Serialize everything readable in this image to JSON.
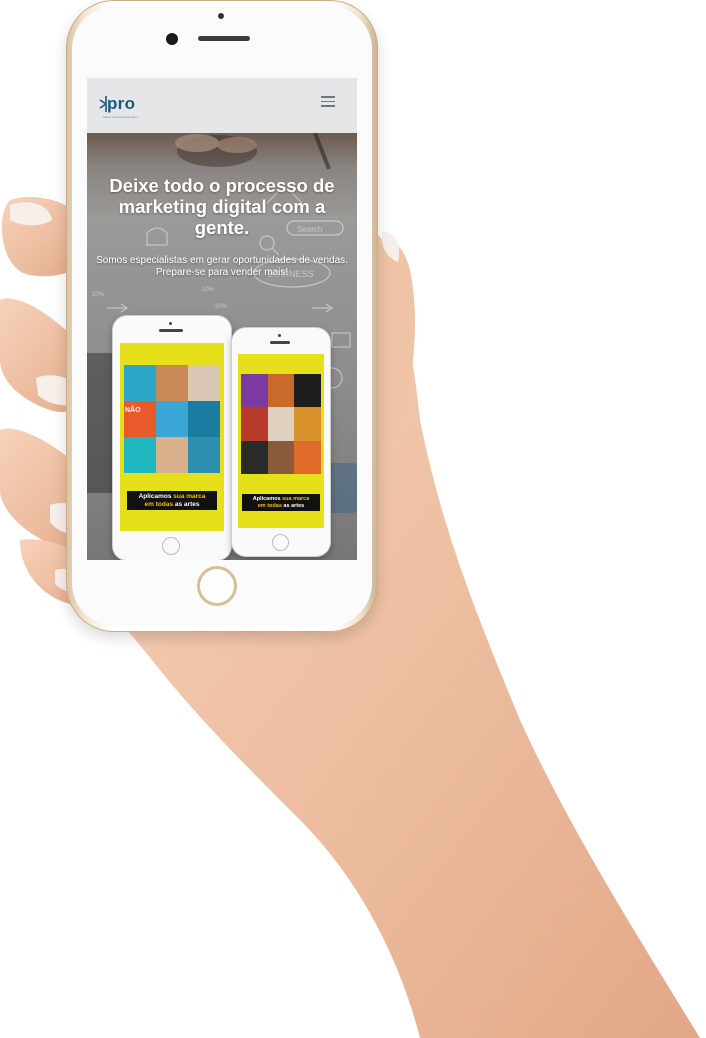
{
  "site": {
    "logo_text": "pro",
    "logo_tagline": "Marca de Posicionamento",
    "menu_icon": "hamburger-menu-icon"
  },
  "hero": {
    "title": "Deixe todo o processo de marketing digital com a gente.",
    "subtitle_line1": "Somos especialistas em gerar oportunidades de vendas.",
    "subtitle_line2": "Prepare-se para vender mais!",
    "doodle_search": "Search",
    "doodle_business": "BUSINESS",
    "doodle_pct1": "20%",
    "doodle_pct2": "10%",
    "doodle_pct3": "30%"
  },
  "mockups": {
    "left_cta": {
      "pre": "Aplicamos ",
      "mid1": "sua marca",
      "sep": " ",
      "mid2": "em todas",
      "post": " as artes"
    },
    "right_cta": {
      "pre": "Aplicamos ",
      "mid1": "sua marca",
      "sep": " ",
      "mid2": "em todas",
      "post": " as artes"
    },
    "left_tile_label": "NÃO"
  },
  "colors": {
    "brand": "#1b5a80",
    "mockup_bg": "#e6e01a",
    "cta_highlight": "#f4c000",
    "phone_gold": "#d8bd95"
  }
}
